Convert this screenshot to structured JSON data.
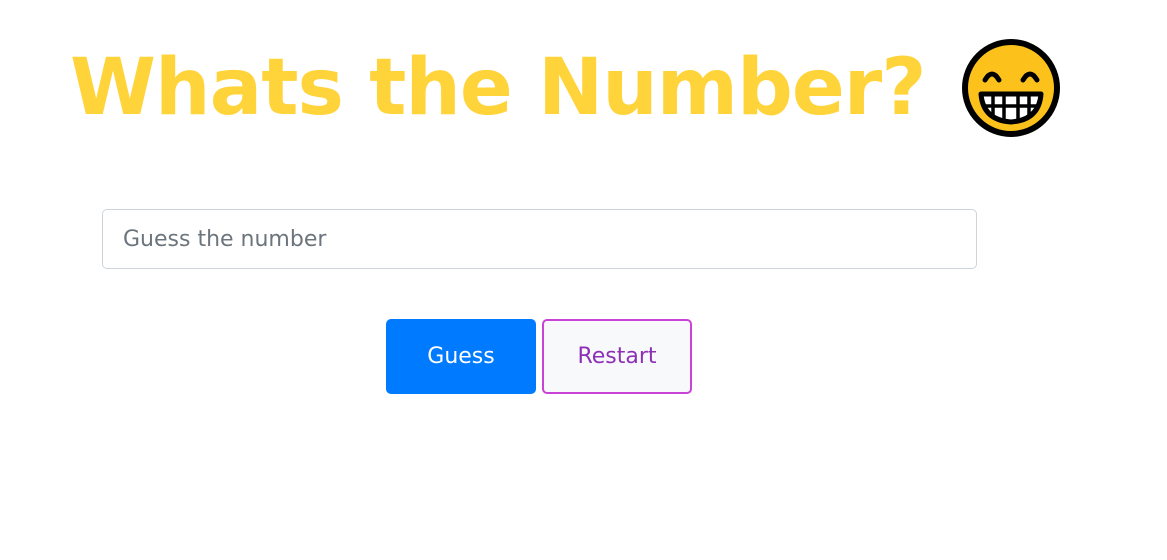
{
  "header": {
    "title": "Whats the Number?",
    "emoji_icon": "grinning-face-icon"
  },
  "form": {
    "input": {
      "value": "",
      "placeholder": "Guess the number"
    },
    "guess_label": "Guess",
    "restart_label": "Restart"
  },
  "colors": {
    "title": "#ffd43b",
    "guess_button": "#007bff",
    "restart_border": "#c944d6",
    "restart_text": "#8e30b5"
  }
}
